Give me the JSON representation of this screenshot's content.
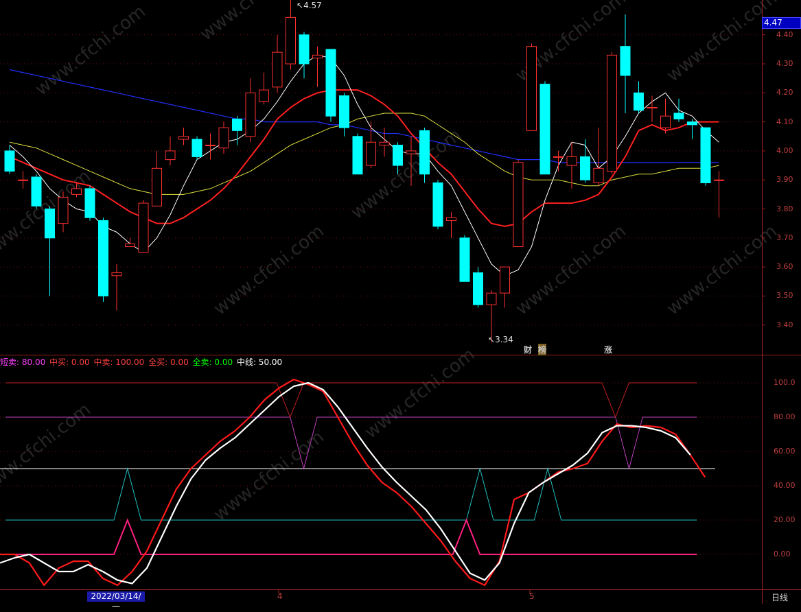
{
  "price_axis": {
    "current_price": "4.47",
    "ticks": [
      "4.40",
      "4.30",
      "4.20",
      "4.10",
      "4.00",
      "3.90",
      "3.80",
      "3.70",
      "3.60",
      "3.50",
      "3.40"
    ]
  },
  "annotations": {
    "high_label": "4.57",
    "low_label": "3.34"
  },
  "markers": [
    {
      "text": "财",
      "color": "#60a0ff"
    },
    {
      "text": "榜",
      "color": "#ffcc66"
    },
    {
      "text": "涨",
      "color": "#ff4040"
    }
  ],
  "indicator": {
    "legend": [
      {
        "label": "短卖: 80.00",
        "color": "#ff40ff"
      },
      {
        "label": "中买: 0.00",
        "color": "#ff4040"
      },
      {
        "label": "中卖: 100.00",
        "color": "#ff4040"
      },
      {
        "label": "全买: 0.00",
        "color": "#ff4040"
      },
      {
        "label": "全卖: 0.00",
        "color": "#00ff00"
      },
      {
        "label": "中线: 50.00",
        "color": "#ffffff"
      }
    ],
    "ticks": [
      "100.0",
      "80.00",
      "60.00",
      "40.00",
      "20.00",
      "0.00"
    ]
  },
  "time_axis": {
    "cursor_date": "2022/03/14/一",
    "months": [
      "4",
      "5"
    ],
    "period": "日线"
  },
  "watermark": "www.cfchi.com",
  "colors": {
    "up": "#ff3030",
    "down": "#00ffff",
    "ma5": "#ffffff",
    "ma10": "#ff2020",
    "ma20": "#e0e040",
    "ma60": "#2030ff"
  },
  "chart_data": {
    "type": "candlestick",
    "candles": [
      {
        "o": 4.0,
        "c": 3.93,
        "h": 4.02,
        "l": 3.92
      },
      {
        "o": 3.9,
        "c": 3.9,
        "h": 3.93,
        "l": 3.87
      },
      {
        "o": 3.91,
        "c": 3.81,
        "h": 3.92,
        "l": 3.8
      },
      {
        "o": 3.8,
        "c": 3.7,
        "h": 3.81,
        "l": 3.5
      },
      {
        "o": 3.75,
        "c": 3.84,
        "h": 3.86,
        "l": 3.72
      },
      {
        "o": 3.85,
        "c": 3.87,
        "h": 3.89,
        "l": 3.84
      },
      {
        "o": 3.87,
        "c": 3.77,
        "h": 3.88,
        "l": 3.76
      },
      {
        "o": 3.76,
        "c": 3.5,
        "h": 3.77,
        "l": 3.48
      },
      {
        "o": 3.57,
        "c": 3.58,
        "h": 3.61,
        "l": 3.45
      },
      {
        "o": 3.67,
        "c": 3.68,
        "h": 3.7,
        "l": 3.67
      },
      {
        "o": 3.65,
        "c": 3.82,
        "h": 3.83,
        "l": 3.65
      },
      {
        "o": 3.81,
        "c": 3.94,
        "h": 4.0,
        "l": 3.81
      },
      {
        "o": 3.97,
        "c": 4.0,
        "h": 4.05,
        "l": 3.95
      },
      {
        "o": 4.04,
        "c": 4.05,
        "h": 4.08,
        "l": 4.02
      },
      {
        "o": 4.04,
        "c": 3.98,
        "h": 4.05,
        "l": 3.97
      },
      {
        "o": 4.02,
        "c": 4.02,
        "h": 4.06,
        "l": 3.97
      },
      {
        "o": 4.01,
        "c": 4.08,
        "h": 4.1,
        "l": 3.99
      },
      {
        "o": 4.11,
        "c": 4.07,
        "h": 4.12,
        "l": 4.02
      },
      {
        "o": 4.05,
        "c": 4.2,
        "h": 4.25,
        "l": 4.03
      },
      {
        "o": 4.17,
        "c": 4.21,
        "h": 4.27,
        "l": 4.16
      },
      {
        "o": 4.22,
        "c": 4.34,
        "h": 4.4,
        "l": 4.2
      },
      {
        "o": 4.3,
        "c": 4.46,
        "h": 4.57,
        "l": 4.28
      },
      {
        "o": 4.4,
        "c": 4.3,
        "h": 4.41,
        "l": 4.25
      },
      {
        "o": 4.32,
        "c": 4.33,
        "h": 4.36,
        "l": 4.22
      },
      {
        "o": 4.35,
        "c": 4.12,
        "h": 4.35,
        "l": 4.1
      },
      {
        "o": 4.19,
        "c": 4.08,
        "h": 4.2,
        "l": 4.05
      },
      {
        "o": 4.05,
        "c": 3.92,
        "h": 4.06,
        "l": 3.92
      },
      {
        "o": 3.95,
        "c": 4.03,
        "h": 4.1,
        "l": 3.94
      },
      {
        "o": 4.02,
        "c": 4.03,
        "h": 4.08,
        "l": 3.98
      },
      {
        "o": 4.02,
        "c": 3.95,
        "h": 4.03,
        "l": 3.92
      },
      {
        "o": 3.99,
        "c": 4.0,
        "h": 4.05,
        "l": 3.88
      },
      {
        "o": 4.07,
        "c": 3.92,
        "h": 4.08,
        "l": 3.89
      },
      {
        "o": 3.89,
        "c": 3.74,
        "h": 3.9,
        "l": 3.73
      },
      {
        "o": 3.76,
        "c": 3.77,
        "h": 3.79,
        "l": 3.7
      },
      {
        "o": 3.7,
        "c": 3.55,
        "h": 3.71,
        "l": 3.55
      },
      {
        "o": 3.58,
        "c": 3.47,
        "h": 3.6,
        "l": 3.46
      },
      {
        "o": 3.47,
        "c": 3.51,
        "h": 3.52,
        "l": 3.34
      },
      {
        "o": 3.51,
        "c": 3.6,
        "h": 3.6,
        "l": 3.46
      },
      {
        "o": 3.67,
        "c": 3.96,
        "h": 3.97,
        "l": 3.67
      },
      {
        "o": 4.07,
        "c": 4.36,
        "h": 4.37,
        "l": 4.07
      },
      {
        "o": 4.23,
        "c": 3.92,
        "h": 4.24,
        "l": 3.92
      },
      {
        "o": 3.98,
        "c": 3.98,
        "h": 4.0,
        "l": 3.93
      },
      {
        "o": 3.95,
        "c": 3.98,
        "h": 4.03,
        "l": 3.87
      },
      {
        "o": 3.98,
        "c": 3.9,
        "h": 4.04,
        "l": 3.89
      },
      {
        "o": 3.89,
        "c": 3.94,
        "h": 4.08,
        "l": 3.88
      },
      {
        "o": 3.93,
        "c": 4.33,
        "h": 4.34,
        "l": 3.92
      },
      {
        "o": 4.36,
        "c": 4.26,
        "h": 4.47,
        "l": 4.13
      },
      {
        "o": 4.2,
        "c": 4.14,
        "h": 4.24,
        "l": 4.13
      },
      {
        "o": 4.15,
        "c": 4.15,
        "h": 4.19,
        "l": 4.1
      },
      {
        "o": 4.08,
        "c": 4.12,
        "h": 4.18,
        "l": 4.06
      },
      {
        "o": 4.13,
        "c": 4.11,
        "h": 4.18,
        "l": 4.1
      },
      {
        "o": 4.1,
        "c": 4.09,
        "h": 4.11,
        "l": 4.04
      },
      {
        "o": 4.08,
        "c": 3.89,
        "h": 4.08,
        "l": 3.88
      },
      {
        "o": 3.9,
        "c": 3.9,
        "h": 3.93,
        "l": 3.77
      }
    ],
    "ma5": [
      4.02,
      3.98,
      3.93,
      3.87,
      3.83,
      3.8,
      3.79,
      3.74,
      3.72,
      3.68,
      3.65,
      3.7,
      3.78,
      3.88,
      3.97,
      4.0,
      4.03,
      4.04,
      4.07,
      4.11,
      4.17,
      4.24,
      4.3,
      4.33,
      4.32,
      4.26,
      4.16,
      4.08,
      4.04,
      4.0,
      3.99,
      3.99,
      3.93,
      3.88,
      3.79,
      3.7,
      3.61,
      3.57,
      3.59,
      3.67,
      3.83,
      3.95,
      4.03,
      4.02,
      3.94,
      3.98,
      4.05,
      4.13,
      4.17,
      4.2,
      4.14,
      4.12,
      4.07,
      4.03
    ],
    "ma10": [
      3.98,
      3.96,
      3.94,
      3.92,
      3.9,
      3.89,
      3.88,
      3.85,
      3.82,
      3.79,
      3.77,
      3.75,
      3.75,
      3.77,
      3.8,
      3.83,
      3.87,
      3.92,
      3.98,
      4.04,
      4.11,
      4.15,
      4.18,
      4.2,
      4.21,
      4.21,
      4.21,
      4.19,
      4.16,
      4.12,
      4.06,
      4.01,
      3.96,
      3.92,
      3.86,
      3.8,
      3.75,
      3.74,
      3.75,
      3.79,
      3.82,
      3.82,
      3.82,
      3.83,
      3.85,
      3.91,
      3.98,
      4.07,
      4.09,
      4.07,
      4.08,
      4.1,
      4.1,
      4.1
    ],
    "ma20": [
      4.03,
      4.02,
      4.01,
      3.99,
      3.97,
      3.95,
      3.93,
      3.91,
      3.89,
      3.87,
      3.86,
      3.85,
      3.85,
      3.85,
      3.86,
      3.87,
      3.89,
      3.91,
      3.93,
      3.96,
      3.99,
      4.02,
      4.04,
      4.06,
      4.08,
      4.09,
      4.11,
      4.12,
      4.13,
      4.13,
      4.13,
      4.12,
      4.09,
      4.06,
      4.03,
      3.99,
      3.96,
      3.93,
      3.91,
      3.9,
      3.9,
      3.9,
      3.89,
      3.88,
      3.88,
      3.9,
      3.91,
      3.92,
      3.92,
      3.93,
      3.94,
      3.94,
      3.94,
      3.95
    ],
    "ma60": [
      4.28,
      4.27,
      4.26,
      4.25,
      4.24,
      4.23,
      4.22,
      4.21,
      4.2,
      4.19,
      4.18,
      4.17,
      4.16,
      4.15,
      4.14,
      4.13,
      4.12,
      4.11,
      4.11,
      4.1,
      4.1,
      4.1,
      4.1,
      4.1,
      4.09,
      4.09,
      4.08,
      4.07,
      4.06,
      4.06,
      4.05,
      4.04,
      4.03,
      4.02,
      4.01,
      4.0,
      3.99,
      3.98,
      3.97,
      3.97,
      3.97,
      3.96,
      3.96,
      3.96,
      3.96,
      3.96,
      3.96,
      3.96,
      3.96,
      3.96,
      3.96,
      3.96,
      3.96,
      3.96
    ],
    "price_ylim": [
      3.3,
      4.52
    ],
    "indicator_ylim": [
      -20,
      110
    ],
    "ind_red": [
      0,
      0,
      -5,
      -18,
      -8,
      -4,
      -4,
      -14,
      -18,
      -10,
      2,
      20,
      38,
      50,
      58,
      66,
      72,
      80,
      90,
      97,
      102,
      99,
      95,
      80,
      65,
      52,
      42,
      36,
      28,
      18,
      8,
      -4,
      -14,
      -18,
      -4,
      32,
      36,
      42,
      48,
      50,
      53,
      66,
      76,
      74,
      75,
      74,
      70,
      58,
      45
    ],
    "ind_white": [
      -5,
      -2,
      0,
      -5,
      -10,
      -10,
      -6,
      -10,
      -15,
      -17,
      -8,
      10,
      28,
      44,
      55,
      62,
      68,
      76,
      84,
      92,
      98,
      100,
      96,
      86,
      74,
      62,
      51,
      42,
      34,
      26,
      15,
      2,
      -11,
      -15,
      -5,
      18,
      36,
      42,
      47,
      52,
      59,
      71,
      75,
      75,
      74,
      72,
      68,
      58
    ],
    "ind_short_sell": [
      80,
      80,
      80,
      80,
      80,
      80,
      80,
      80,
      80,
      80,
      80,
      80,
      80,
      80,
      80,
      80,
      80,
      80,
      80,
      80,
      80,
      80,
      50,
      80,
      80,
      80,
      80,
      80,
      80,
      80,
      80,
      80,
      80,
      80,
      80,
      80,
      80,
      80,
      80,
      80,
      80,
      80,
      80,
      80,
      80,
      80,
      50,
      80,
      80,
      80,
      80,
      80
    ],
    "ind_mid_sell": [
      100,
      100,
      100,
      100,
      100,
      100,
      100,
      100,
      100,
      100,
      100,
      100,
      100,
      100,
      100,
      100,
      100,
      100,
      100,
      100,
      100,
      80,
      100,
      100,
      100,
      100,
      100,
      100,
      100,
      100,
      100,
      100,
      100,
      100,
      100,
      100,
      100,
      100,
      100,
      100,
      100,
      100,
      100,
      100,
      100,
      80,
      100,
      100,
      100,
      100,
      100,
      100
    ],
    "ind_cyan": [
      20,
      20,
      20,
      20,
      20,
      20,
      20,
      20,
      20,
      50,
      20,
      20,
      20,
      20,
      20,
      20,
      20,
      20,
      20,
      20,
      20,
      20,
      20,
      20,
      20,
      20,
      20,
      20,
      20,
      20,
      20,
      20,
      20,
      20,
      20,
      50,
      20,
      20,
      20,
      20,
      50,
      20,
      20,
      20,
      20,
      20,
      20,
      20,
      20,
      20,
      20,
      20
    ],
    "ind_pink": [
      0,
      0,
      0,
      0,
      0,
      0,
      0,
      0,
      0,
      20,
      0,
      0,
      0,
      0,
      0,
      0,
      0,
      0,
      0,
      0,
      0,
      0,
      0,
      0,
      0,
      0,
      0,
      0,
      0,
      0,
      0,
      0,
      0,
      0,
      20,
      0,
      0,
      0,
      0,
      0,
      0,
      0,
      0,
      0,
      0,
      0,
      0,
      0,
      0,
      0,
      0,
      0
    ],
    "ind_midline": 50
  }
}
